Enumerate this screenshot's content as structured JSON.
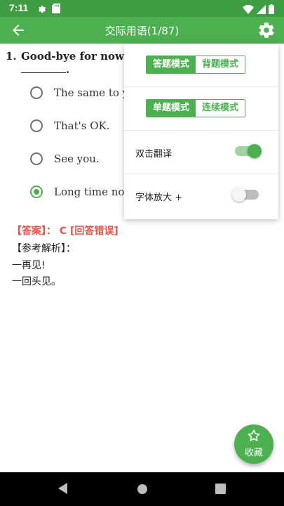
{
  "status_bar": {
    "time": "7:11",
    "left_icons": [
      "gear-icon",
      "sd-card-icon"
    ],
    "right_icons": [
      "wifi-icon",
      "signal-icon",
      "battery-icon"
    ]
  },
  "app_bar": {
    "title": "交际用语(1/87)",
    "back_icon": "arrow-back-icon",
    "settings_icon": "gear-icon"
  },
  "question": {
    "number": "1.",
    "text": "Good-bye for now.",
    "blank_suffix": ".",
    "options": [
      {
        "label": "The same to y",
        "selected": false
      },
      {
        "label": "That's OK.",
        "selected": false
      },
      {
        "label": "See you.",
        "selected": false
      },
      {
        "label": "Long time no",
        "selected": true
      }
    ]
  },
  "answer": {
    "text": "【答案】： C  [回答错误]",
    "analysis_title": "【参考解析】：",
    "analysis_lines": [
      "一再见!",
      "一回头见。"
    ]
  },
  "menu": {
    "mode_group": {
      "options": [
        "答题模式",
        "背题模式"
      ],
      "selected": "答题模式"
    },
    "flow_group": {
      "options": [
        "单题模式",
        "连续模式"
      ],
      "selected": "单题模式"
    },
    "double_tap_translate": {
      "label": "双击翻译",
      "on": true
    },
    "font_enlarge": {
      "label": "字体放大 +",
      "on": false
    }
  },
  "fab": {
    "label": "收藏",
    "icon": "star-icon"
  },
  "colors": {
    "primary": "#4caf50",
    "status_bar": "#3f9e44",
    "answer_red": "#e5534b"
  }
}
